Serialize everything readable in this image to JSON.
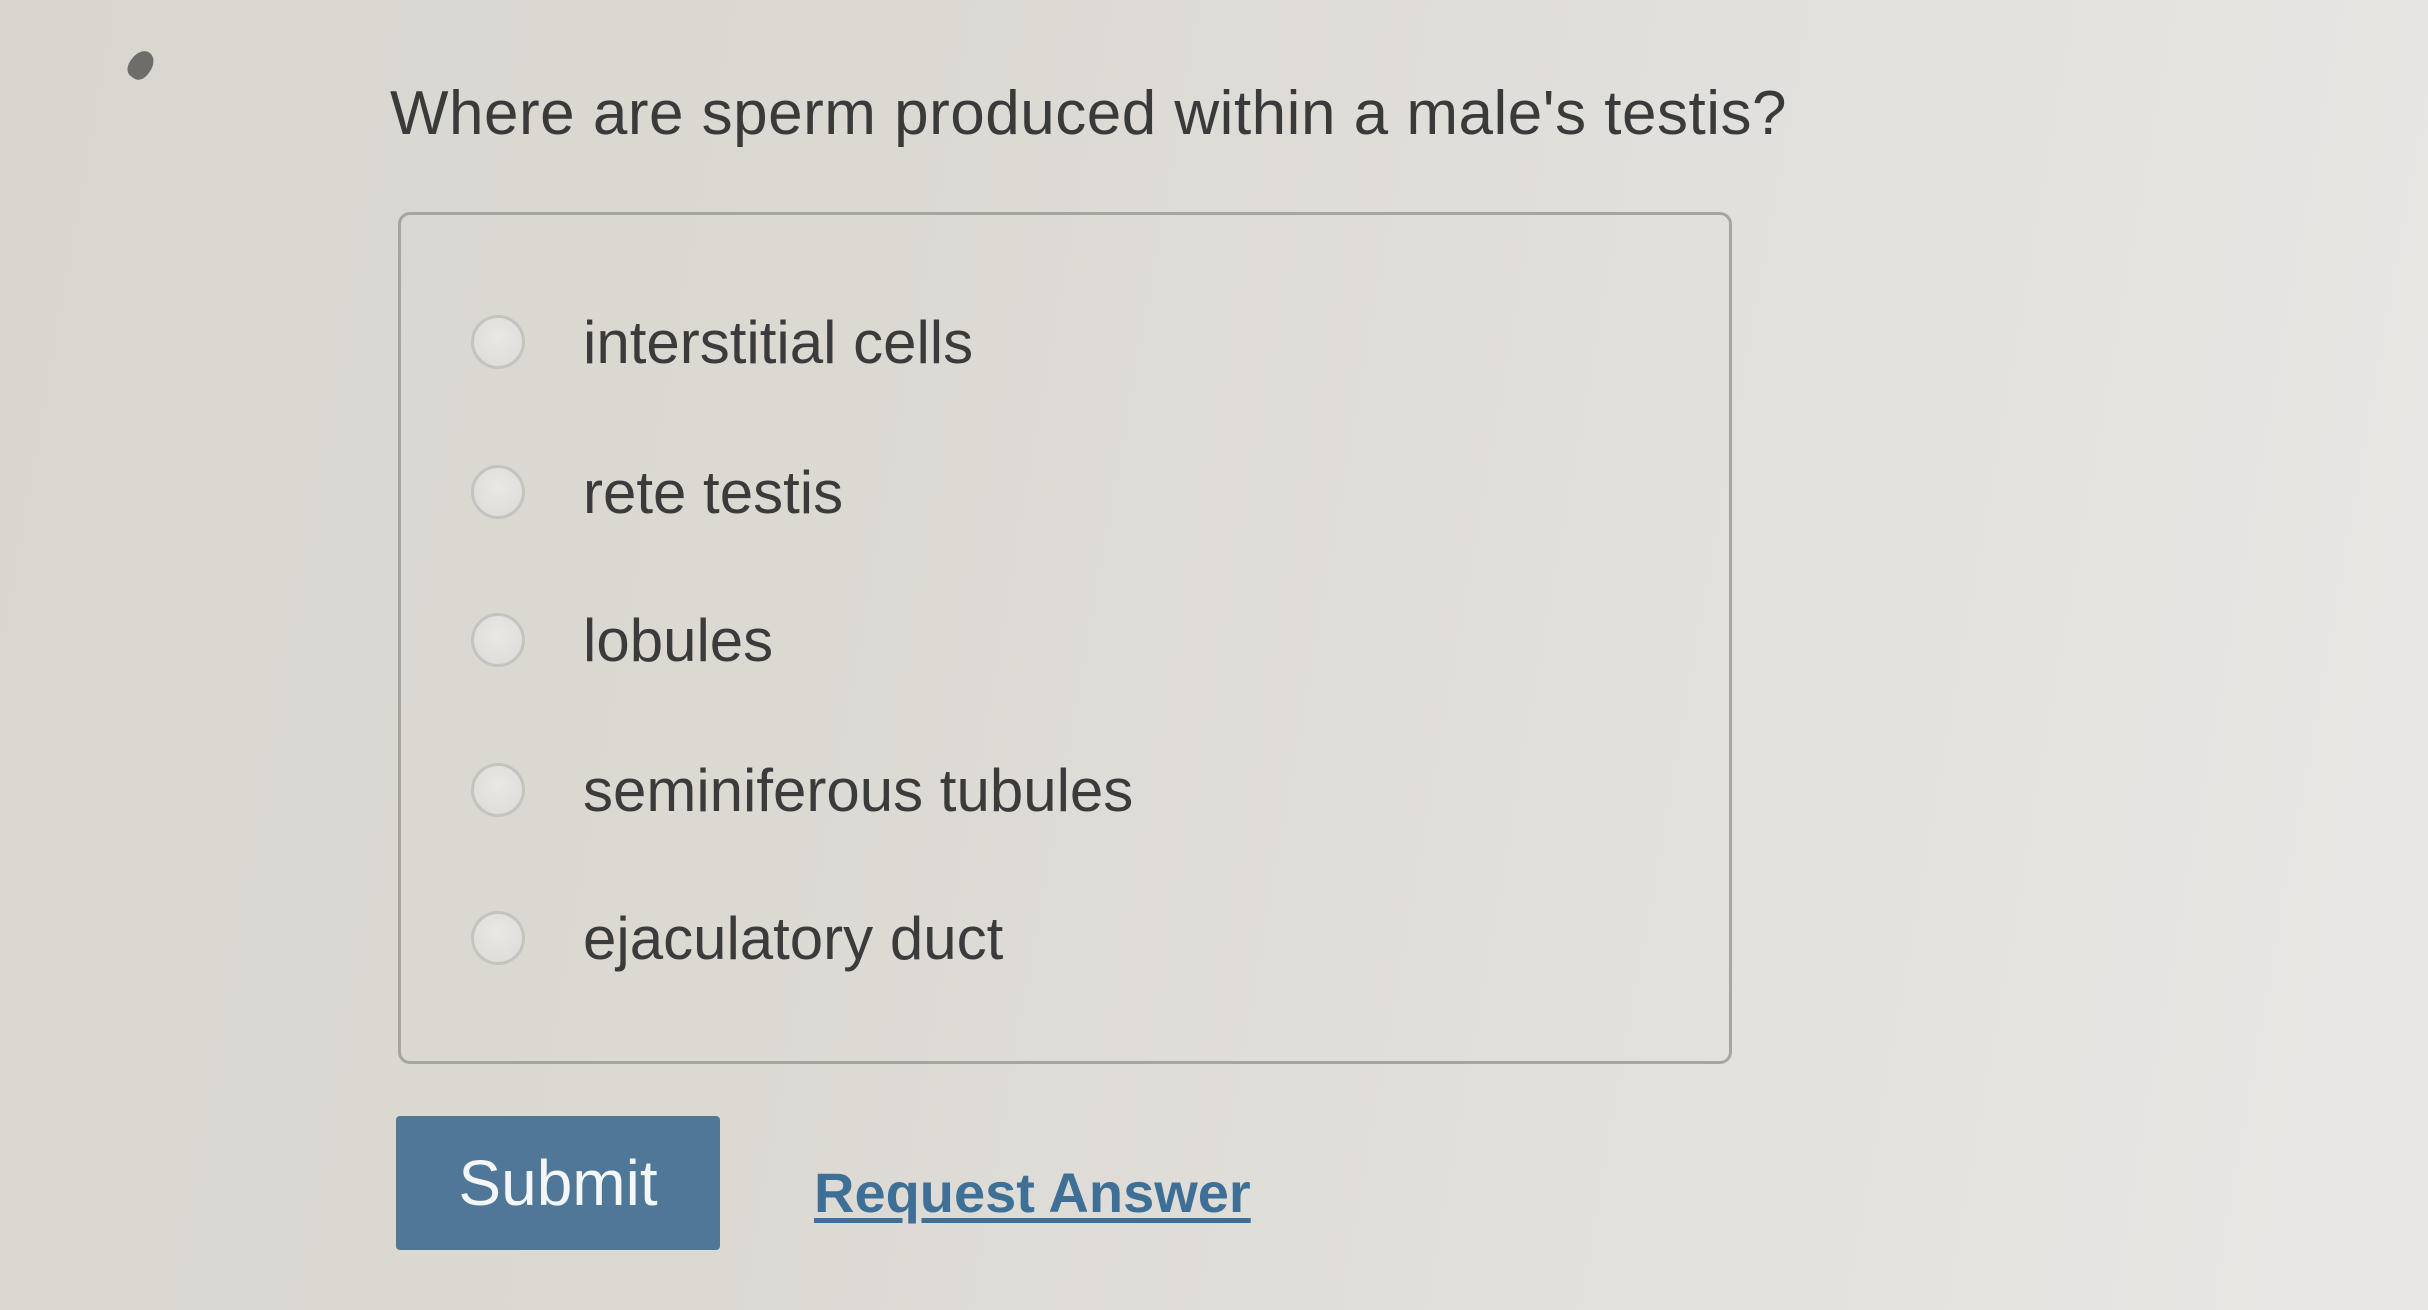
{
  "question": {
    "text": "Where are sperm produced within a male's testis?"
  },
  "options": [
    {
      "label": "interstitial cells",
      "selected": false
    },
    {
      "label": "rete testis",
      "selected": false
    },
    {
      "label": "lobules",
      "selected": false
    },
    {
      "label": "seminiferous tubules",
      "selected": false
    },
    {
      "label": "ejaculatory duct",
      "selected": false
    }
  ],
  "actions": {
    "submit_label": "Submit",
    "request_answer_label": "Request Answer"
  },
  "colors": {
    "submit_bg": "#4f7898",
    "link": "#3e6f96"
  }
}
